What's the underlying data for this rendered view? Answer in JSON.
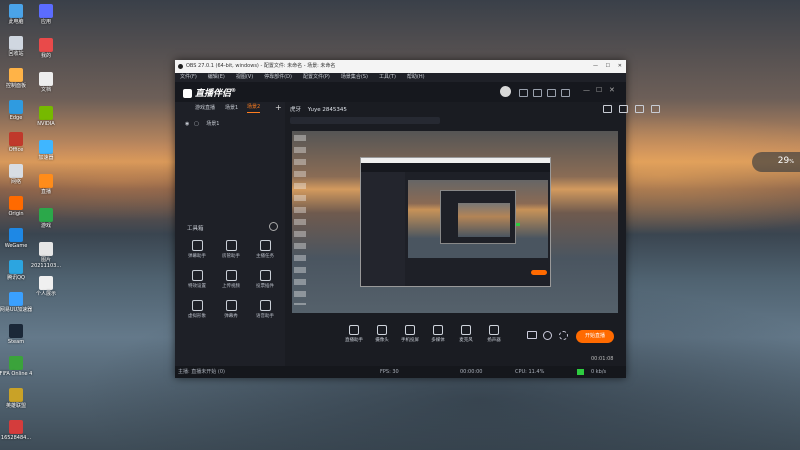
{
  "desktop": {
    "icons_left": [
      {
        "label": "此电脑",
        "color": "#4aa3e8"
      },
      {
        "label": "回收站",
        "color": "#d0d7e0"
      },
      {
        "label": "控制面板",
        "color": "#ffb347"
      },
      {
        "label": "Edge",
        "color": "#2f9be0"
      },
      {
        "label": "Office",
        "color": "#c0392b"
      },
      {
        "label": "网络",
        "color": "#d8dde3"
      },
      {
        "label": "Origin",
        "color": "#ff6a00"
      },
      {
        "label": "WeGame",
        "color": "#1e88e5"
      },
      {
        "label": "腾讯QQ",
        "color": "#2ca5e0"
      },
      {
        "label": "网易UU加速器",
        "color": "#3aa0ff"
      },
      {
        "label": "Steam",
        "color": "#1b2838"
      },
      {
        "label": "FIFA Online 4",
        "color": "#3ba33b"
      },
      {
        "label": "英雄联盟",
        "color": "#c9a227"
      },
      {
        "label": "16528484...",
        "color": "#d43c3c"
      }
    ],
    "icons_right": [
      {
        "label": "应用",
        "color": "#5b6cff"
      },
      {
        "label": "我的",
        "color": "#e94a4a"
      },
      {
        "label": "文档",
        "color": "#eeeeee"
      },
      {
        "label": "NVIDIA",
        "color": "#76b900"
      },
      {
        "label": "加速器",
        "color": "#3fb6ff"
      },
      {
        "label": "直播",
        "color": "#ff8c1a"
      },
      {
        "label": "游戏",
        "color": "#2ba84a"
      },
      {
        "label": "图片 20211103...",
        "color": "#e6e6e6"
      },
      {
        "label": "个人展示",
        "color": "#f0f0f0"
      }
    ]
  },
  "gauge": {
    "value": "29",
    "unit": "%"
  },
  "window": {
    "title": "OBS 27.0.1 (64-bit, windows) - 配置文件: 未命名 - 场景: 未命名",
    "menus": [
      "文件(F)",
      "编辑(E)",
      "视图(V)",
      "停靠部件(D)",
      "配置文件(P)",
      "场景集合(S)",
      "工具(T)",
      "帮助(H)"
    ],
    "app_name": "直播伴侣",
    "room": {
      "platform": "虎牙",
      "id": "Yuye 2845345"
    },
    "tabs": [
      "游戏直播",
      "场景1",
      "场景2"
    ],
    "scene_label": "场景1",
    "toolbox_label": "工具箱",
    "tools": [
      "弹幕助手",
      "房管助手",
      "主播任务",
      "特效设置",
      "上传视频",
      "投票插件",
      "虚拟形象",
      "弹幕秀",
      "语音助手"
    ],
    "bottom_tools": [
      "直播助手",
      "摄像头",
      "手机投屏",
      "多媒体",
      "麦克风",
      "扬声器"
    ],
    "start_label": "开始直播",
    "timer": "00:01:08",
    "status": {
      "left": "主播: 直播未开始 (0)",
      "fps": "FPS: 30",
      "cpu": "CPU: 11.4%",
      "time": "00:00:00",
      "rate": "0 kb/s"
    }
  }
}
